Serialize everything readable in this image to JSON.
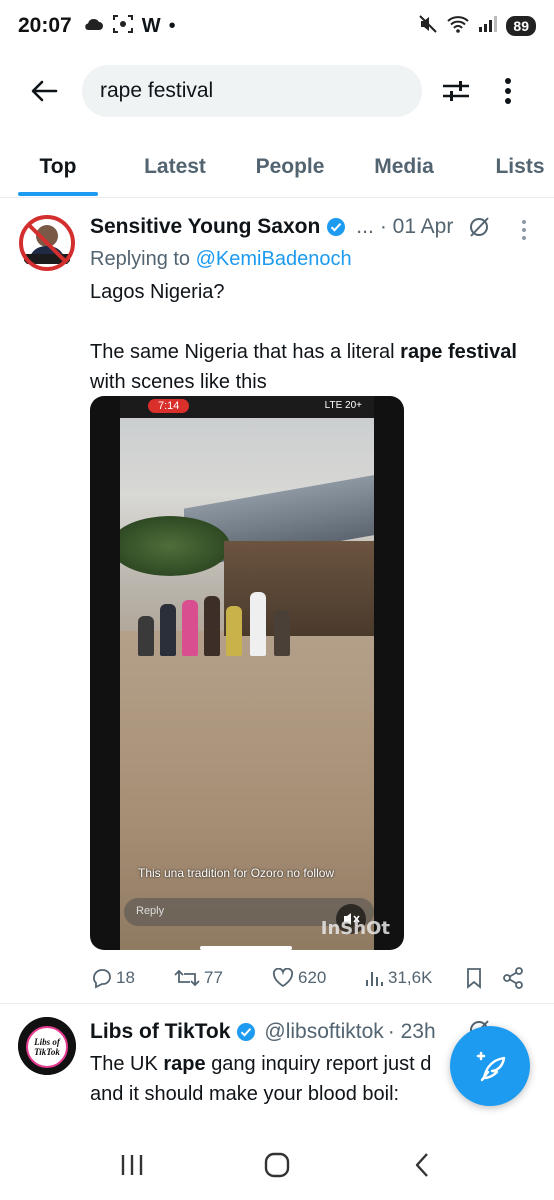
{
  "status_bar": {
    "time": "20:07",
    "w_label": "W",
    "dot": "•",
    "battery": "89",
    "icons": [
      "cloud-icon",
      "screenshot-icon",
      "mute-icon",
      "wifi-icon",
      "signal-icon"
    ]
  },
  "search": {
    "query": "rape festival",
    "icons": [
      "back-arrow-icon",
      "filter-icon",
      "more-vertical-icon"
    ]
  },
  "tabs": [
    {
      "label": "Top",
      "active": true
    },
    {
      "label": "Latest",
      "active": false
    },
    {
      "label": "People",
      "active": false
    },
    {
      "label": "Media",
      "active": false
    },
    {
      "label": "Lists",
      "active": false
    }
  ],
  "tweets": [
    {
      "name": "Sensitive Young Saxon",
      "ellipsis": "...",
      "date": "· 01 Apr",
      "reply_prefix": "Replying to",
      "reply_to": "@KemiBadenoch",
      "text_line1": "Lagos Nigeria?",
      "text_pre": "The same Nigeria that has a literal",
      "text_bold": "rape festival",
      "text_post": "with scenes like this",
      "avatar_text": "WE'RE WITH LOWE",
      "video": {
        "phone_time": "7:14",
        "phone_net": "LTE 20+",
        "caption": "This una tradition for Ozoro no follow",
        "reply_placeholder": "Reply",
        "watermark": "InShOt"
      },
      "stats": {
        "replies": "18",
        "reposts": "77",
        "likes": "620",
        "views": "31,6K"
      }
    },
    {
      "name": "Libs of TikTok",
      "handle": "@libsoftiktok",
      "date": "· 23h",
      "text_pre": "The UK",
      "text_bold": "rape",
      "text_post": "gang inquiry report just d",
      "text_line2": "and it should make your blood boil:",
      "avatar_text": "Libs of TikTok"
    }
  ],
  "colors": {
    "accent": "#1d9bf0",
    "text": "#0f1419",
    "secondary": "#536471",
    "search_bg": "#eff3f4"
  }
}
